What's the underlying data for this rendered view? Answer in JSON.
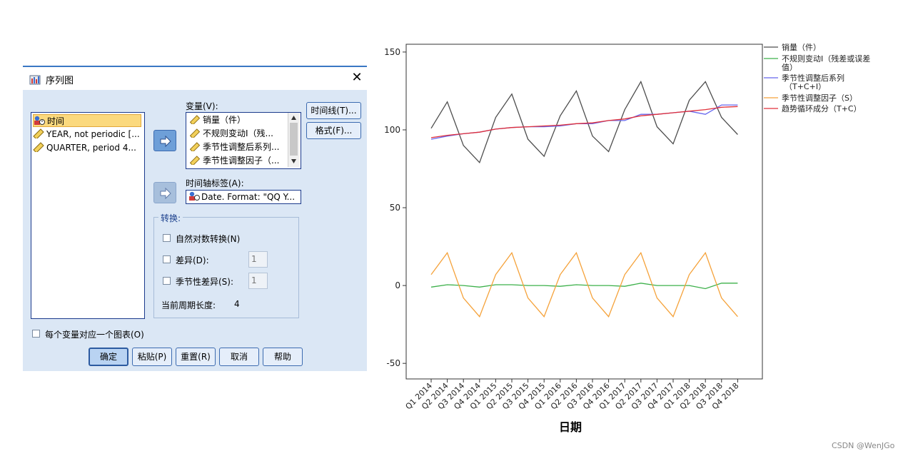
{
  "dialog": {
    "title": "序列图",
    "close": "✕",
    "source_items": [
      {
        "label": "时间",
        "icon": "date-variable-icon",
        "selected": true
      },
      {
        "label": "YEAR, not periodic [...",
        "icon": "ruler-icon",
        "selected": false
      },
      {
        "label": "QUARTER, period 4...",
        "icon": "ruler-icon",
        "selected": false
      }
    ],
    "variables_label": "变量(V):",
    "variables": [
      "销量（件）",
      "不规则变动I（残...",
      "季节性调整后系列...",
      "季节性调整因子（..."
    ],
    "axis_label_label": "时间轴标签(A):",
    "axis_label_value": "Date.  Format:  \"QQ Y...",
    "time_lines_button": "时间线(T)...",
    "format_button": "格式(F)...",
    "transform": {
      "title": "转换:",
      "natural_log": "自然对数转换(N)",
      "difference": "差异(D):",
      "difference_value": "1",
      "seasonal_difference": "季节性差异(S):",
      "seasonal_difference_value": "1",
      "period_label": "当前周期长度:",
      "period_value": "4"
    },
    "one_chart_per_variable": "每个变量对应一个图表(O)",
    "buttons": {
      "ok": "确定",
      "paste": "粘贴(P)",
      "reset": "重置(R)",
      "cancel": "取消",
      "help": "帮助"
    }
  },
  "chart_data": {
    "type": "line",
    "xlabel": "日期",
    "ylabel": "",
    "ylim": [
      -60,
      155
    ],
    "yticks": [
      150,
      100,
      50,
      0,
      -50
    ],
    "categories": [
      "Q1 2014",
      "Q2 2014",
      "Q3 2014",
      "Q4 2014",
      "Q1 2015",
      "Q2 2015",
      "Q3 2015",
      "Q4 2015",
      "Q1 2016",
      "Q2 2016",
      "Q3 2016",
      "Q4 2016",
      "Q1 2017",
      "Q2 2017",
      "Q3 2017",
      "Q4 2017",
      "Q1 2018",
      "Q2 2018",
      "Q3 2018",
      "Q4 2018"
    ],
    "legend_position": "right",
    "series": [
      {
        "name": "销量（件）",
        "color": "#4d4d4d",
        "values": [
          101,
          118,
          90,
          79,
          108,
          123,
          94,
          83,
          109,
          125,
          96,
          86,
          113,
          131,
          102,
          91,
          119,
          131,
          108,
          97
        ]
      },
      {
        "name": "不规则变动I（残差或误差值）",
        "color": "#3cb04a",
        "values": [
          -1,
          0.5,
          0,
          -1,
          0.5,
          0.5,
          0,
          0,
          -0.5,
          0.5,
          0,
          0,
          -0.5,
          1.5,
          0,
          0,
          0,
          -2,
          1.5,
          1.5
        ]
      },
      {
        "name": "季节性调整后系列（T+C+I）",
        "color": "#6666ee",
        "values": [
          94,
          96,
          97.5,
          98.5,
          100.5,
          101.5,
          102,
          102,
          102.5,
          104,
          104,
          106,
          106,
          110,
          110,
          111,
          112,
          110,
          116,
          116
        ]
      },
      {
        "name": "季节性调整因子（S）",
        "color": "#f5a23a",
        "values": [
          7,
          21,
          -8,
          -20,
          7,
          21,
          -8,
          -20,
          7,
          21,
          -8,
          -20,
          7,
          21,
          -8,
          -20,
          7,
          21,
          -8,
          -20
        ]
      },
      {
        "name": "趋势循环成分（T+C）",
        "color": "#e0303a",
        "values": [
          95,
          96.5,
          97.5,
          98.5,
          100.5,
          101.5,
          102,
          102.5,
          103,
          104,
          104.5,
          106,
          107,
          109,
          110,
          111,
          112,
          113,
          114.5,
          115
        ]
      }
    ]
  },
  "watermark": "CSDN @WenJGo"
}
